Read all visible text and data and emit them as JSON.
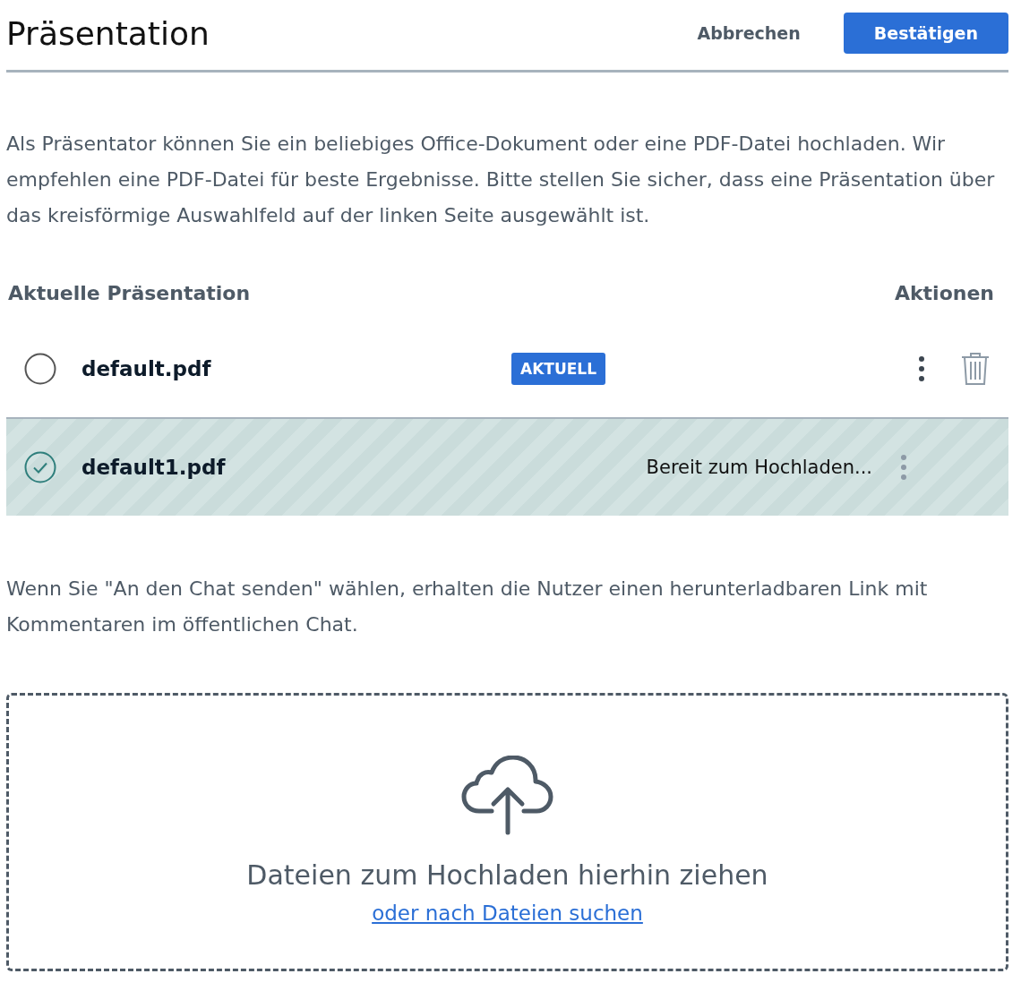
{
  "header": {
    "title": "Präsentation",
    "cancel": "Abbrechen",
    "confirm": "Bestätigen"
  },
  "intro": "Als Präsentator können Sie ein beliebiges Office-Dokument oder eine PDF-Datei hochladen. Wir empfehlen eine PDF-Datei für beste Ergebnisse. Bitte stellen Sie sicher, dass eine Präsentation über das kreisförmige Auswahlfeld auf der linken Seite ausgewählt ist.",
  "table": {
    "columns": [
      "Aktuelle Präsentation",
      "Aktionen"
    ],
    "rows": [
      {
        "kind": "uploaded",
        "name": "default.pdf",
        "selected": false,
        "badge": "AKTUELL"
      },
      {
        "kind": "pending",
        "name": "default1.pdf",
        "selected": true,
        "status": "Bereit zum Hochladen..."
      }
    ]
  },
  "note": "Wenn Sie \"An den Chat senden\" wählen, erhalten die Nutzer einen herunterladbaren Link mit Kommentaren im öffentlichen Chat.",
  "dropzone": {
    "text": "Dateien zum Hochladen hierhin ziehen",
    "link": "oder nach Dateien suchen"
  }
}
